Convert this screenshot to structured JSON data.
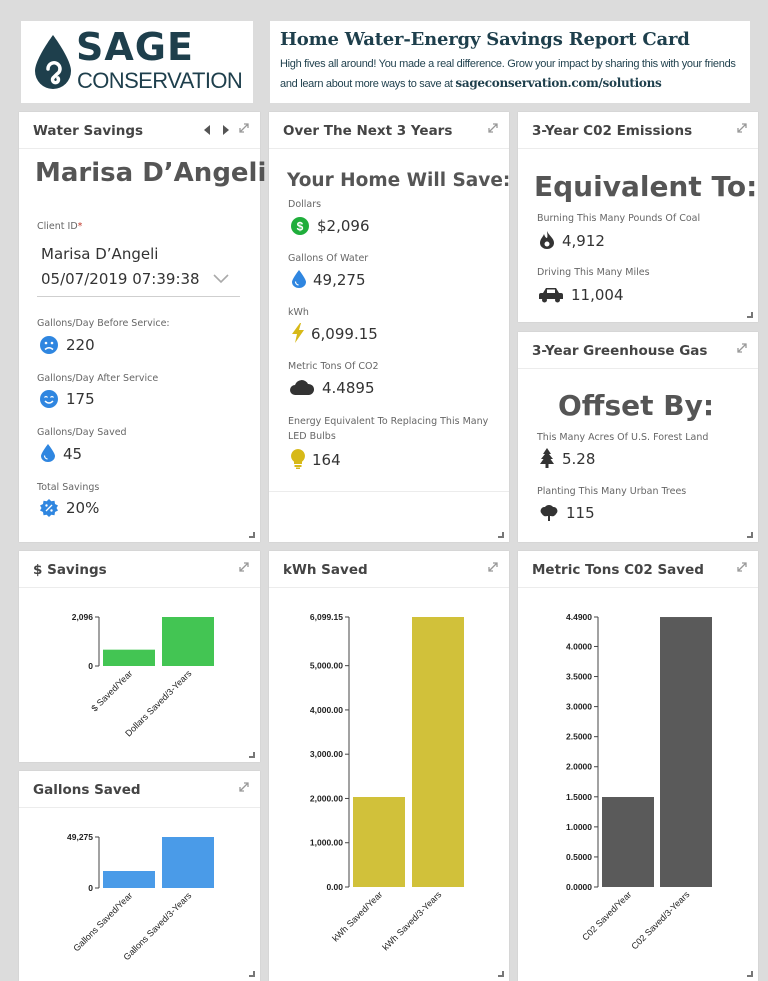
{
  "header": {
    "logo_top": "SAGE",
    "logo_bottom": "CONSERVATION",
    "title": "Home Water-Energy Savings Report Card",
    "line1": "High fives all around! You made a real difference. Grow your impact by sharing this with your friends",
    "line2_prefix": "and learn about more ways to save at ",
    "line2_link": "sageconservation.com/solutions"
  },
  "water": {
    "title": "Water Savings",
    "name": "Marisa D’Angeli",
    "client_label": "Client ID",
    "client_required": "*",
    "client_name": "Marisa D’Angeli",
    "client_date": "05/07/2019 07:39:38",
    "before_label": "Gallons/Day Before Service:",
    "before_value": "220",
    "after_label": "Gallons/Day After Service",
    "after_value": "175",
    "saved_label": "Gallons/Day Saved",
    "saved_value": "45",
    "total_label": "Total Savings",
    "total_value": "20%"
  },
  "next3": {
    "title": "Over The Next 3 Years",
    "heading": "Your Home Will Save:",
    "dollars_label": "Dollars",
    "dollars_value": "$2,096",
    "gallons_label": "Gallons Of Water",
    "gallons_value": "49,275",
    "kwh_label": "kWh",
    "kwh_value": "6,099.15",
    "co2_label": "Metric Tons Of CO2",
    "co2_value": "4.4895",
    "led_label_1": "Energy Equivalent To Replacing This Many",
    "led_label_2": "LED Bulbs",
    "led_value": "164"
  },
  "emissions": {
    "title": "3-Year C02 Emissions",
    "heading": "Equivalent To:",
    "coal_label": "Burning This Many Pounds Of Coal",
    "coal_value": "4,912",
    "miles_label": "Driving This Many Miles",
    "miles_value": "11,004"
  },
  "ghg": {
    "title": "3-Year Greenhouse Gas",
    "heading": "Offset By:",
    "forest_label": "This Many Acres Of U.S. Forest Land",
    "forest_value": "5.28",
    "trees_label": "Planting This Many Urban Trees",
    "trees_value": "115"
  },
  "icons": {
    "nav_prev": "chevron-left-icon",
    "nav_next": "chevron-right-icon",
    "expand": "expand-icon",
    "resize": "resize-corner-icon",
    "dropdown": "chevron-down-icon",
    "sad": "sad-face-icon",
    "happy": "happy-face-icon",
    "drop": "water-drop-icon",
    "percent": "percent-badge-icon",
    "dollar": "dollar-circle-icon",
    "bolt": "lightning-bolt-icon",
    "cloud": "cloud-icon",
    "bulb": "light-bulb-icon",
    "flame": "flame-icon",
    "car": "car-icon",
    "pine": "pine-tree-icon",
    "tree": "tree-icon"
  },
  "colors": {
    "brand": "#1e3f4c",
    "green": "#43c553",
    "blue": "#4a9be8",
    "olive": "#d1c13a",
    "gray": "#5a5a5a",
    "accent_red": "#c0392b"
  },
  "chart_data": [
    {
      "type": "bar",
      "panel_title": "$ Savings",
      "categories": [
        "$ Saved/Year",
        "Dollars Saved/3-Years"
      ],
      "values": [
        698.67,
        2096
      ],
      "ticks": [
        "0",
        "2,096"
      ],
      "tick_values": [
        0,
        2096
      ],
      "ylim": [
        0,
        2096
      ],
      "color": "#43c553"
    },
    {
      "type": "bar",
      "panel_title": "Gallons Saved",
      "categories": [
        "Gallons Saved/Year",
        "Gallons Saved/3-Years"
      ],
      "values": [
        16425,
        49275
      ],
      "ticks": [
        "0",
        "49,275"
      ],
      "tick_values": [
        0,
        49275
      ],
      "ylim": [
        0,
        49275
      ],
      "color": "#4a9be8"
    },
    {
      "type": "bar",
      "panel_title": "kWh Saved",
      "categories": [
        "kWh Saved/Year",
        "kWh Saved/3-Years"
      ],
      "values": [
        2033.05,
        6099.15
      ],
      "ticks": [
        "0.00",
        "1,000.00",
        "2,000.00",
        "3,000.00",
        "4,000.00",
        "5,000.00",
        "6,099.15"
      ],
      "tick_values": [
        0,
        1000,
        2000,
        3000,
        4000,
        5000,
        6099.15
      ],
      "ylim": [
        0,
        6099.15
      ],
      "color": "#d1c13a"
    },
    {
      "type": "bar",
      "panel_title": "Metric Tons C02 Saved",
      "categories": [
        "C02 Saved/Year",
        "C02 Saved/3-Years"
      ],
      "values": [
        1.4965,
        4.4895
      ],
      "ticks": [
        "0.0000",
        "0.5000",
        "1.0000",
        "1.5000",
        "2.0000",
        "2.5000",
        "3.0000",
        "3.5000",
        "4.0000",
        "4.4900"
      ],
      "tick_values": [
        0,
        0.5,
        1,
        1.5,
        2,
        2.5,
        3,
        3.5,
        4,
        4.49
      ],
      "ylim": [
        0,
        4.49
      ],
      "color": "#5a5a5a"
    }
  ]
}
